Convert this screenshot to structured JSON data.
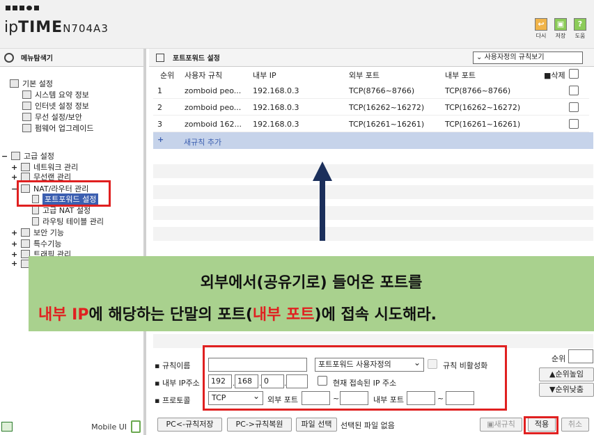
{
  "header": {
    "logo_ip": "ip",
    "logo_time": "TIME",
    "logo_model": "N704A3",
    "buttons": [
      {
        "label": "다시",
        "icon": "refresh-icon"
      },
      {
        "label": "저장",
        "icon": "save-icon"
      },
      {
        "label": "도움",
        "icon": "help-icon"
      }
    ]
  },
  "sidebar": {
    "title": "메뉴탐색기",
    "basic": {
      "label": "기본 설정",
      "items": [
        "시스템 요약 정보",
        "인터넷 설정 정보",
        "무선 설정/보안",
        "펌웨어 업그레이드"
      ]
    },
    "advanced": {
      "label": "고급 설정",
      "items": [
        "네트워크 관리",
        "무선랜 관리",
        "NAT/라우터 관리",
        "포트포워드 설정",
        "고급 NAT 설정",
        "라우팅 테이블 관리",
        "보안 기능",
        "특수기능",
        "트래픽 관리"
      ]
    },
    "footer": {
      "mobile_label": "Mobile UI"
    }
  },
  "main": {
    "title": "포트포워드 설정",
    "view_select": "사용자정의 규칙보기",
    "columns": {
      "rank": "순위",
      "rule": "사용자 규칙",
      "inner_ip": "내부 IP",
      "ext_port": "외부 포트",
      "int_port": "내부 포트",
      "delete": "삭제"
    },
    "rows": [
      {
        "rank": "1",
        "rule": "zomboid peo...",
        "ip": "192.168.0.3",
        "ext": "TCP(8766~8766)",
        "int": "TCP(8766~8766)"
      },
      {
        "rank": "2",
        "rule": "zomboid peo...",
        "ip": "192.168.0.3",
        "ext": "TCP(16262~16272)",
        "int": "TCP(16262~16272)"
      },
      {
        "rank": "3",
        "rule": "zomboid 162...",
        "ip": "192.168.0.3",
        "ext": "TCP(16261~16261)",
        "int": "TCP(16261~16261)"
      }
    ],
    "add_rule": "새규칙 추가"
  },
  "overlay": {
    "line1": "외부에서(공유기로)  들어온 포트를",
    "line2_a": "내부 IP",
    "line2_b": "에 해당하는 단말의 포트(",
    "line2_c": "내부 포트",
    "line2_d": ")에 접속 시도해라."
  },
  "form": {
    "rule_name_label": "▪ 규칙이름",
    "rule_name_value": "",
    "rule_type": "포트포워드 사용자정의",
    "disable_label": "규칙 비활성화",
    "inner_ip_label": "▪ 내부 IP주소",
    "ip1": "192",
    "ip2": "168",
    "ip3": "0",
    "ip4": "",
    "current_ip_label": "현재 접속된 IP 주소",
    "protocol_label": "▪ 프로토콜",
    "protocol": "TCP",
    "ext_port_label": "외부 포트",
    "int_port_label": "내부 포트",
    "tilde": "~",
    "rank_label": "순위",
    "rank_up": "▲순위높임",
    "rank_down": "▼순위낮춤"
  },
  "bottom": {
    "pc_save": "PC<-규칙저장",
    "pc_restore": "PC->규칙복원",
    "file_select": "파일 선택",
    "file_status": "선택된 파일 없음",
    "new_rule": "새규칙",
    "apply": "적용",
    "cancel": "취소"
  },
  "colors": {
    "accent": "#3c5fb0",
    "highlight_red": "#e02020",
    "overlay_green": "#a9d18e",
    "arrow": "#1b2f5b"
  }
}
